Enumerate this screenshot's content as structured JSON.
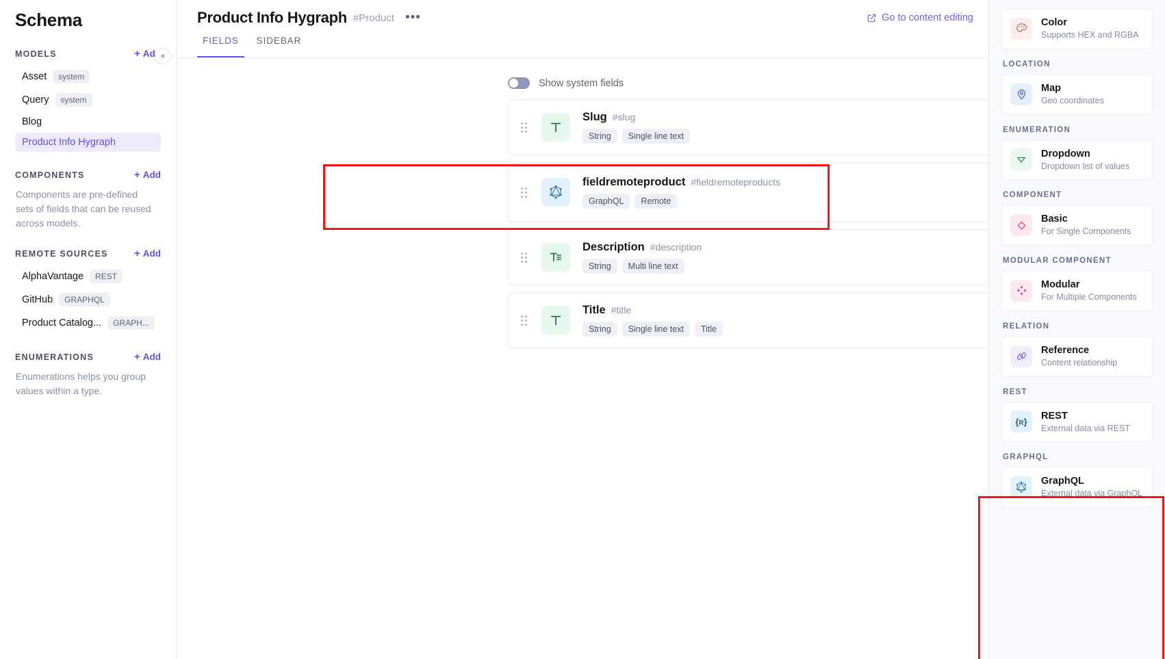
{
  "sidebar": {
    "title": "Schema",
    "sections": [
      {
        "heading": "MODELS",
        "add_label": "Add",
        "items": [
          {
            "label": "Asset",
            "badge": "system",
            "active": false
          },
          {
            "label": "Query",
            "badge": "system",
            "active": false
          },
          {
            "label": "Blog",
            "badge": "",
            "active": false
          },
          {
            "label": "Product Info Hygraph",
            "badge": "",
            "active": true
          }
        ],
        "description": ""
      },
      {
        "heading": "COMPONENTS",
        "add_label": "Add",
        "items": [],
        "description": "Components are pre-defined sets of fields that can be reused across models."
      },
      {
        "heading": "REMOTE SOURCES",
        "add_label": "Add",
        "items": [
          {
            "label": "AlphaVantage",
            "badge": "REST",
            "active": false
          },
          {
            "label": "GitHub",
            "badge": "GRAPHQL",
            "active": false
          },
          {
            "label": "Product Catalog...",
            "badge": "GRAPH...",
            "active": false
          }
        ],
        "description": ""
      },
      {
        "heading": "ENUMERATIONS",
        "add_label": "Add",
        "items": [],
        "description": "Enumerations helps you group values within a type."
      }
    ]
  },
  "collapse_button": {
    "icon": "chevron-double-left-icon",
    "glyph": "«"
  },
  "header": {
    "title": "Product Info Hygraph",
    "api_id": "#Product",
    "more_menu": "•••",
    "go_to_content_editing": "Go to content editing",
    "go_to_content_editing_icon": "external-edit-icon"
  },
  "tabs": [
    {
      "label": "FIELDS",
      "active": true
    },
    {
      "label": "SIDEBAR",
      "active": false
    }
  ],
  "toolbar": {
    "show_system_fields_label": "Show system fields",
    "show_system_fields_on": false
  },
  "fields": [
    {
      "name": "Slug",
      "api_id": "#slug",
      "icon": "single-line-text-icon",
      "icon_glyph": "T",
      "icon_color": "green",
      "tags": [
        "String",
        "Single line text"
      ],
      "highlighted": false
    },
    {
      "name": "fieldremoteproduct",
      "api_id": "#fieldremoteproducts",
      "icon": "graphql-icon",
      "icon_glyph": "",
      "icon_color": "blue",
      "tags": [
        "GraphQL",
        "Remote"
      ],
      "highlighted": true
    },
    {
      "name": "Description",
      "api_id": "#description",
      "icon": "multi-line-text-icon",
      "icon_glyph": "",
      "icon_color": "green",
      "tags": [
        "String",
        "Multi line text"
      ],
      "highlighted": false
    },
    {
      "name": "Title",
      "api_id": "#title",
      "icon": "single-line-text-icon",
      "icon_glyph": "T",
      "icon_color": "green",
      "tags": [
        "String",
        "Single line text",
        "Title"
      ],
      "highlighted": false
    }
  ],
  "field_types_panel": {
    "groups": [
      {
        "heading": "",
        "items": [
          {
            "title": "Color",
            "subtitle": "Supports HEX and RGBA",
            "icon": "palette-icon",
            "icon_color": "pinkish"
          }
        ]
      },
      {
        "heading": "LOCATION",
        "items": [
          {
            "title": "Map",
            "subtitle": "Geo coordinates",
            "icon": "map-pin-icon",
            "icon_color": "lightblue"
          }
        ]
      },
      {
        "heading": "ENUMERATION",
        "items": [
          {
            "title": "Dropdown",
            "subtitle": "Dropdown list of values",
            "icon": "dropdown-triangle-icon",
            "icon_color": "greenish"
          }
        ]
      },
      {
        "heading": "COMPONENT",
        "items": [
          {
            "title": "Basic",
            "subtitle": "For Single Components",
            "icon": "diamond-icon",
            "icon_color": "pink"
          }
        ]
      },
      {
        "heading": "MODULAR COMPONENT",
        "items": [
          {
            "title": "Modular",
            "subtitle": "For Multiple Components",
            "icon": "four-diamonds-icon",
            "icon_color": "pink"
          }
        ]
      },
      {
        "heading": "RELATION",
        "items": [
          {
            "title": "Reference",
            "subtitle": "Content relationship",
            "icon": "link-chain-icon",
            "icon_color": "lilac"
          }
        ]
      },
      {
        "heading": "REST",
        "items": [
          {
            "title": "REST",
            "subtitle": "External data via REST",
            "icon": "rest-braces-icon",
            "icon_color": "cyan"
          }
        ]
      },
      {
        "heading": "GRAPHQL",
        "items": [
          {
            "title": "GraphQL",
            "subtitle": "External data via GraphQL",
            "icon": "graphql-icon",
            "icon_color": "cyan"
          }
        ]
      }
    ]
  },
  "annotations": {
    "colors": {
      "highlight": "#ff1111",
      "accent": "#5b55e0"
    }
  }
}
